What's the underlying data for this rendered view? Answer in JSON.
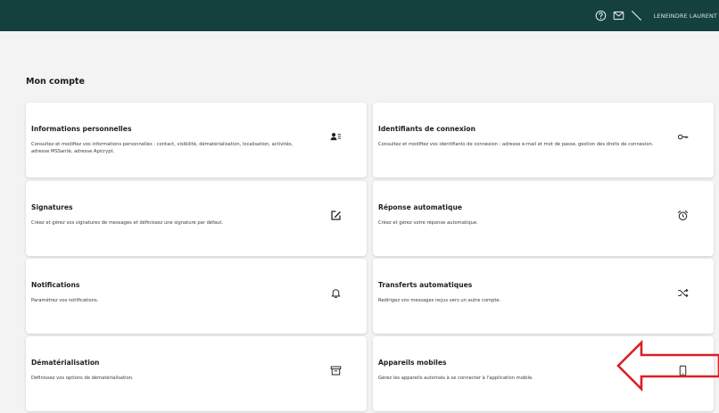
{
  "header": {
    "user_name": "LENEINDRE LAURENT",
    "icons": [
      "help-icon",
      "mail-icon",
      "diagonal-line-icon"
    ]
  },
  "page": {
    "title": "Mon compte"
  },
  "cards": [
    {
      "title": "Informations personnelles",
      "description": "Consultez et modifiez vos informations personnelles : contact, visibilité, dématérialisation, localisation, activités, adresse MSSanté, adresse Apicrypt.",
      "icon": "contact-card-icon"
    },
    {
      "title": "Identifiants de connexion",
      "description": "Consultez et modifiez vos identifiants de connexion : adresse e-mail et mot de passe, gestion des droits de connexion.",
      "icon": "key-icon"
    },
    {
      "title": "Signatures",
      "description": "Créez et gérez vos signatures de messages et définissez une signature par défaut.",
      "icon": "edit-icon"
    },
    {
      "title": "Réponse automatique",
      "description": "Créez et gérez votre réponse automatique.",
      "icon": "alarm-clock-icon"
    },
    {
      "title": "Notifications",
      "description": "Paramétrez vos notifications.",
      "icon": "bell-icon"
    },
    {
      "title": "Transferts automatiques",
      "description": "Redirigez vos messages reçus vers un autre compte.",
      "icon": "shuffle-icon"
    },
    {
      "title": "Dématérialisation",
      "description": "Définissez vos options de dématérialisation.",
      "icon": "archive-box-icon"
    },
    {
      "title": "Appareils mobiles",
      "description": "Gérez les appareils autorisés à se connecter à l'application mobile.",
      "icon": "mobile-phone-icon"
    }
  ],
  "colors": {
    "header_bg": "#14403d",
    "page_bg": "#f3f3f3",
    "card_bg": "#ffffff",
    "annotation_arrow": "#d91f26"
  },
  "annotations": {
    "arrow_icon": "red-left-arrow-icon"
  }
}
